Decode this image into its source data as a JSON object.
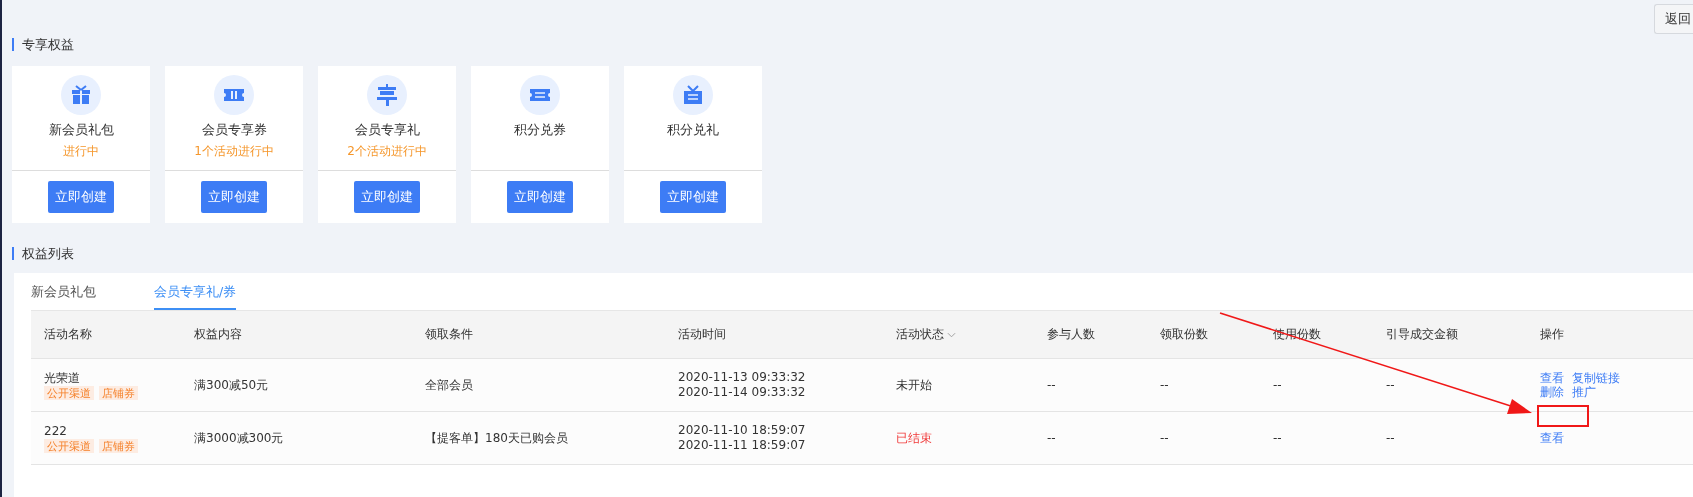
{
  "back_button": {
    "label": "返回"
  },
  "benefits_section": {
    "title": "专享权益",
    "cards": [
      {
        "kind": "gift",
        "title": "新会员礼包",
        "status": "进行中",
        "button": "立即创建"
      },
      {
        "kind": "ticket",
        "title": "会员专享券",
        "status": "1个活动进行中",
        "button": "立即创建"
      },
      {
        "kind": "enjoy",
        "title": "会员专享礼",
        "status": "2个活动进行中",
        "button": "立即创建"
      },
      {
        "kind": "exchange",
        "title": "积分兑券",
        "button": "立即创建"
      },
      {
        "kind": "giftexchange",
        "title": "积分兑礼",
        "button": "立即创建"
      }
    ]
  },
  "list_section": {
    "title": "权益列表",
    "tabs": [
      {
        "label": "新会员礼包",
        "selected": false
      },
      {
        "label": "会员专享礼/券",
        "selected": true
      }
    ],
    "table": {
      "columns": [
        "活动名称",
        "权益内容",
        "领取条件",
        "活动时间",
        "活动状态",
        "参与人数",
        "领取份数",
        "使用份数",
        "引导成交金额",
        "操作"
      ],
      "rows": [
        {
          "name": "光荣道",
          "tags": [
            "公开渠道",
            "店铺券"
          ],
          "content": "满300减50元",
          "condition": "全部会员",
          "time_start": "2020-11-13 09:33:32",
          "time_end": "2020-11-14 09:33:32",
          "status": {
            "kind": "pending",
            "label": "未开始"
          },
          "participants": "--",
          "claimed": "--",
          "used": "--",
          "amount": "--",
          "actions": [
            "查看",
            "复制链接",
            "删除",
            "推广"
          ]
        },
        {
          "name": "222",
          "tags": [
            "公开渠道",
            "店铺券"
          ],
          "content": "满3000减300元",
          "condition": "【提客单】180天已购会员",
          "time_start": "2020-11-10 18:59:07",
          "time_end": "2020-11-11 18:59:07",
          "status": {
            "kind": "ended",
            "label": "已结束"
          },
          "participants": "--",
          "claimed": "--",
          "used": "--",
          "amount": "--",
          "actions": [
            "查看"
          ]
        }
      ]
    }
  }
}
